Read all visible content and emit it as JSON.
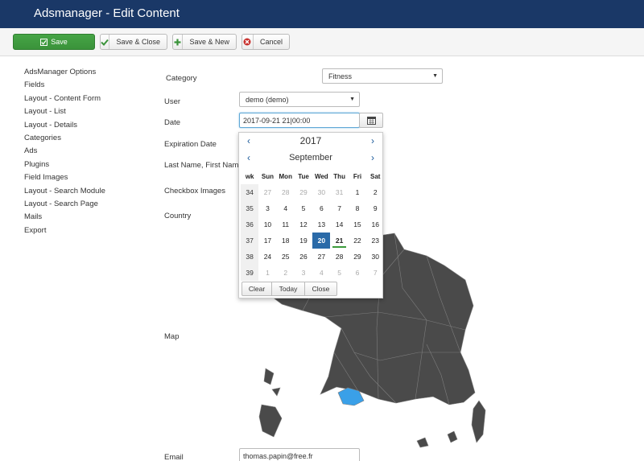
{
  "header": {
    "title": "Adsmanager - Edit Content"
  },
  "toolbar": {
    "save": "Save",
    "save_close": "Save & Close",
    "save_new": "Save & New",
    "cancel": "Cancel"
  },
  "sidebar": {
    "items": [
      "AdsManager Options",
      "Fields",
      "Layout - Content Form",
      "Layout - List",
      "Layout - Details",
      "Categories",
      "Ads",
      "Plugins",
      "Field Images",
      "Layout - Search Module",
      "Layout - Search Page",
      "Mails",
      "Export"
    ]
  },
  "form": {
    "category_label": "Category",
    "category_value": "Fitness",
    "user_label": "User",
    "user_value": "demo (demo)",
    "date_label": "Date",
    "date_value": "2017-09-21 21|00:00",
    "expiration_label": "Expiration Date",
    "name_label": "Last Name, First Name",
    "checkbox_label": "Checkbox Images",
    "country_label": "Country",
    "map_label": "Map",
    "email_label": "Email",
    "email_value": "thomas.papin@free.fr"
  },
  "calendar": {
    "year": "2017",
    "month": "September",
    "prev": "‹",
    "next": "›",
    "weekdays": [
      "wk",
      "Sun",
      "Mon",
      "Tue",
      "Wed",
      "Thu",
      "Fri",
      "Sat"
    ],
    "weeks": [
      [
        "34",
        "27",
        "28",
        "29",
        "30",
        "31",
        "1",
        "2"
      ],
      [
        "35",
        "3",
        "4",
        "5",
        "6",
        "7",
        "8",
        "9"
      ],
      [
        "36",
        "10",
        "11",
        "12",
        "13",
        "14",
        "15",
        "16"
      ],
      [
        "37",
        "17",
        "18",
        "19",
        "20",
        "21",
        "22",
        "23"
      ],
      [
        "38",
        "24",
        "25",
        "26",
        "27",
        "28",
        "29",
        "30"
      ],
      [
        "39",
        "1",
        "2",
        "3",
        "4",
        "5",
        "6",
        "7"
      ]
    ],
    "selected_day": "20",
    "today_day": "21",
    "clear": "Clear",
    "today": "Today",
    "close": "Close"
  },
  "colors": {
    "header_bg": "#1a3867",
    "save_green": "#46a546",
    "selected_blue": "#2a6aa8",
    "map_fill": "#4a4a4a",
    "map_highlight": "#3aa0e8"
  }
}
